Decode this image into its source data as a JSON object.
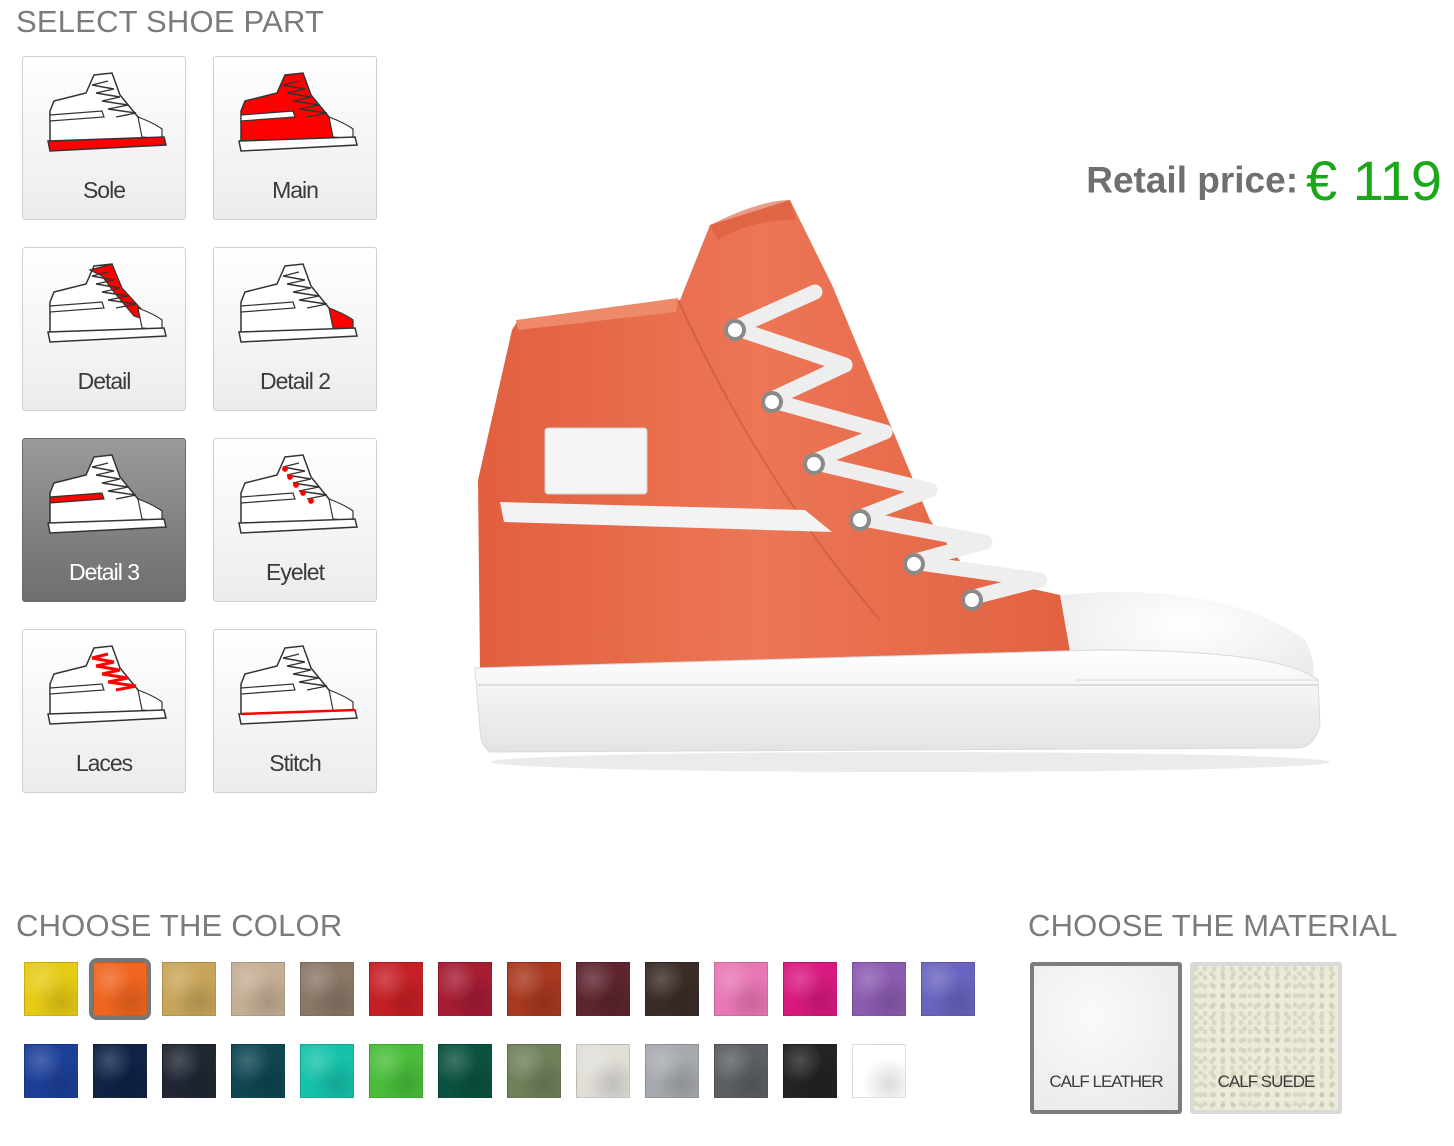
{
  "parts_section": {
    "title": "SELECT SHOE PART",
    "items": [
      {
        "label": "Sole",
        "icon": "shoe-sole-icon"
      },
      {
        "label": "Main",
        "icon": "shoe-main-icon"
      },
      {
        "label": "Detail",
        "icon": "shoe-detail-icon"
      },
      {
        "label": "Detail 2",
        "icon": "shoe-detail2-icon"
      },
      {
        "label": "Detail 3",
        "icon": "shoe-detail3-icon"
      },
      {
        "label": "Eyelet",
        "icon": "shoe-eyelet-icon"
      },
      {
        "label": "Laces",
        "icon": "shoe-laces-icon"
      },
      {
        "label": "Stitch",
        "icon": "shoe-stitch-icon"
      }
    ],
    "selected": "Detail 3",
    "highlight_color": "#ff0000"
  },
  "price": {
    "label": "Retail price:",
    "value": "€ 119",
    "value_color": "#1aa81a"
  },
  "preview": {
    "icon": "high-top-sneaker-preview",
    "main_color": "#e8704f",
    "sole_color": "#f2f2f2",
    "laces_color": "#f0f0f0"
  },
  "color_section": {
    "title": "CHOOSE THE COLOR",
    "selected_index": 1,
    "swatches": [
      "#e6cb14",
      "#f0651f",
      "#c8a559",
      "#c4ae94",
      "#8a7766",
      "#c52025",
      "#a51c33",
      "#a8381f",
      "#5e2530",
      "#3b2c27",
      "#e877b4",
      "#d8197e",
      "#8b5bb0",
      "#6a63bf",
      "#1c3f98",
      "#0f2347",
      "#202733",
      "#0f4652",
      "#16c2aa",
      "#49bd3a",
      "#0b5240",
      "#70805a",
      "#e0ded7",
      "#a6a9ae",
      "#5b5f63",
      "#232323",
      "#ffffff"
    ]
  },
  "material_section": {
    "title": "CHOOSE THE MATERIAL",
    "selected": "CALF LEATHER",
    "items": [
      {
        "label": "CALF LEATHER"
      },
      {
        "label": "CALF SUEDE"
      }
    ]
  }
}
